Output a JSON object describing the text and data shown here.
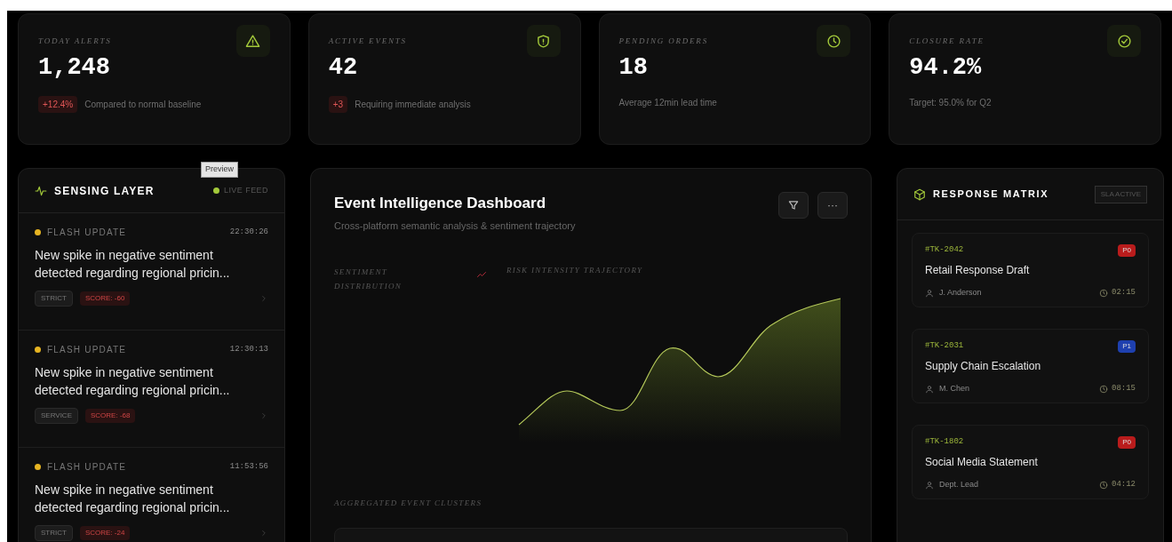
{
  "stats": [
    {
      "label": "TODAY ALERTS",
      "value": "1,248",
      "delta": "+12.4%",
      "note": "Compared to normal baseline"
    },
    {
      "label": "ACTIVE EVENTS",
      "value": "42",
      "delta": "+3",
      "note": "Requiring immediate analysis"
    },
    {
      "label": "PENDING ORDERS",
      "value": "18",
      "note": "Average 12min lead time"
    },
    {
      "label": "CLOSURE RATE",
      "value": "94.2%",
      "note": "Target: 95.0% for Q2"
    }
  ],
  "sensing": {
    "title": "SENSING LAYER",
    "live": "LIVE FEED",
    "tooltip": "Preview",
    "items": [
      {
        "type": "FLASH UPDATE",
        "time": "22:30:26",
        "text": "New spike in negative sentiment detected regarding regional pricin...",
        "tag": "STRICT",
        "score": "SCORE: -60"
      },
      {
        "type": "FLASH UPDATE",
        "time": "12:30:13",
        "text": "New spike in negative sentiment detected regarding regional pricin...",
        "tag": "SERVICE",
        "score": "SCORE: -68"
      },
      {
        "type": "FLASH UPDATE",
        "time": "11:53:56",
        "text": "New spike in negative sentiment detected regarding regional pricin...",
        "tag": "STRICT",
        "score": "SCORE: -24"
      }
    ]
  },
  "dashboard": {
    "title": "Event Intelligence Dashboard",
    "subtitle": "Cross-platform semantic analysis & sentiment trajectory",
    "legend_left": "SENTIMENT DISTRIBUTION",
    "legend_right": "RISK INTENSITY TRAJECTORY",
    "section": "AGGREGATED EVENT CLUSTERS",
    "more": "···"
  },
  "response": {
    "title": "RESPONSE MATRIX",
    "badge": "SLA ACTIVE",
    "items": [
      {
        "id": "#TK-2042",
        "priority": "P0",
        "color": "#b91c1c",
        "title": "Retail Response Draft",
        "assignee": "J. Anderson",
        "time": "02:15"
      },
      {
        "id": "#TK-2031",
        "priority": "P1",
        "color": "#1e40af",
        "title": "Supply Chain Escalation",
        "assignee": "M. Chen",
        "time": "08:15"
      },
      {
        "id": "#TK-1802",
        "priority": "P0",
        "color": "#b91c1c",
        "title": "Social Media Statement",
        "assignee": "Dept. Lead",
        "time": "04:12"
      }
    ]
  }
}
